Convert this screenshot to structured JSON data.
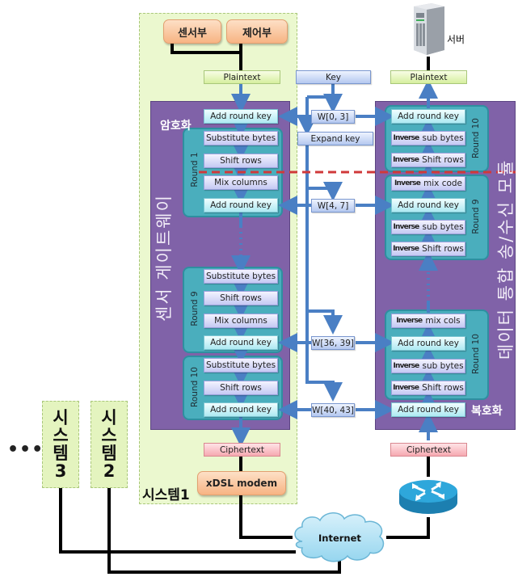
{
  "systems": {
    "system1_label": "시스템1",
    "system2": [
      "시",
      "스",
      "템",
      "2"
    ],
    "system3": [
      "시",
      "스",
      "템",
      "3"
    ],
    "more": "•••"
  },
  "sensor_gateway": {
    "sensor_unit": "센서부",
    "control_unit": "제어부",
    "plaintext": "Plaintext",
    "panel_title": "센서 게이트웨이",
    "encrypt_label": "암호화",
    "initial_add_round_key": "Add round key",
    "rounds": [
      {
        "label": "Round 1",
        "steps": [
          "Substitute bytes",
          "Shift rows",
          "Mix columns",
          "Add round key"
        ]
      },
      {
        "label": "Round 9",
        "steps": [
          "Substitute bytes",
          "Shift rows",
          "Mix columns",
          "Add round key"
        ]
      },
      {
        "label": "Round 10",
        "steps": [
          "Substitute bytes",
          "Shift rows",
          "Add round key"
        ]
      }
    ],
    "ciphertext": "Ciphertext",
    "modem": "xDSL modem"
  },
  "key_schedule": {
    "key": "Key",
    "expand_key": "Expand key",
    "words": [
      "W[0, 3]",
      "W[4, 7]",
      "W[36, 39]",
      "W[40, 43]"
    ]
  },
  "server_side": {
    "server_label": "서버",
    "plaintext": "Plaintext",
    "panel_title": "데이터 통합 송/수신 모듈",
    "decrypt_label": "복호화",
    "inverse_prefix": "Inverse",
    "rounds": [
      {
        "label": "Round 10",
        "steps": [
          {
            "text": "Add round key",
            "inverse": false
          },
          {
            "text": "sub bytes",
            "inverse": true
          },
          {
            "text": "Shift rows",
            "inverse": true
          }
        ]
      },
      {
        "label": "Round 9",
        "steps": [
          {
            "text": "mix code",
            "inverse": true
          },
          {
            "text": "Add round key",
            "inverse": false
          },
          {
            "text": "sub bytes",
            "inverse": true
          },
          {
            "text": "Shift rows",
            "inverse": true
          }
        ]
      },
      {
        "label": "Round 10",
        "steps": [
          {
            "text": "mix cols",
            "inverse": true
          },
          {
            "text": "Add round key",
            "inverse": false
          },
          {
            "text": "sub bytes",
            "inverse": true
          },
          {
            "text": "Shift rows",
            "inverse": true
          }
        ]
      }
    ],
    "final_add_round_key": "Add round key",
    "ciphertext": "Ciphertext"
  },
  "network": {
    "internet": "Internet",
    "router_icon": "router-icon",
    "server_icon": "server-icon"
  },
  "colors": {
    "flow_arrow": "#4a7fc4",
    "purple_panel": "#8062a8",
    "teal_round": "#4aaebd",
    "divider": "#d0393a",
    "wire": "#000000"
  }
}
